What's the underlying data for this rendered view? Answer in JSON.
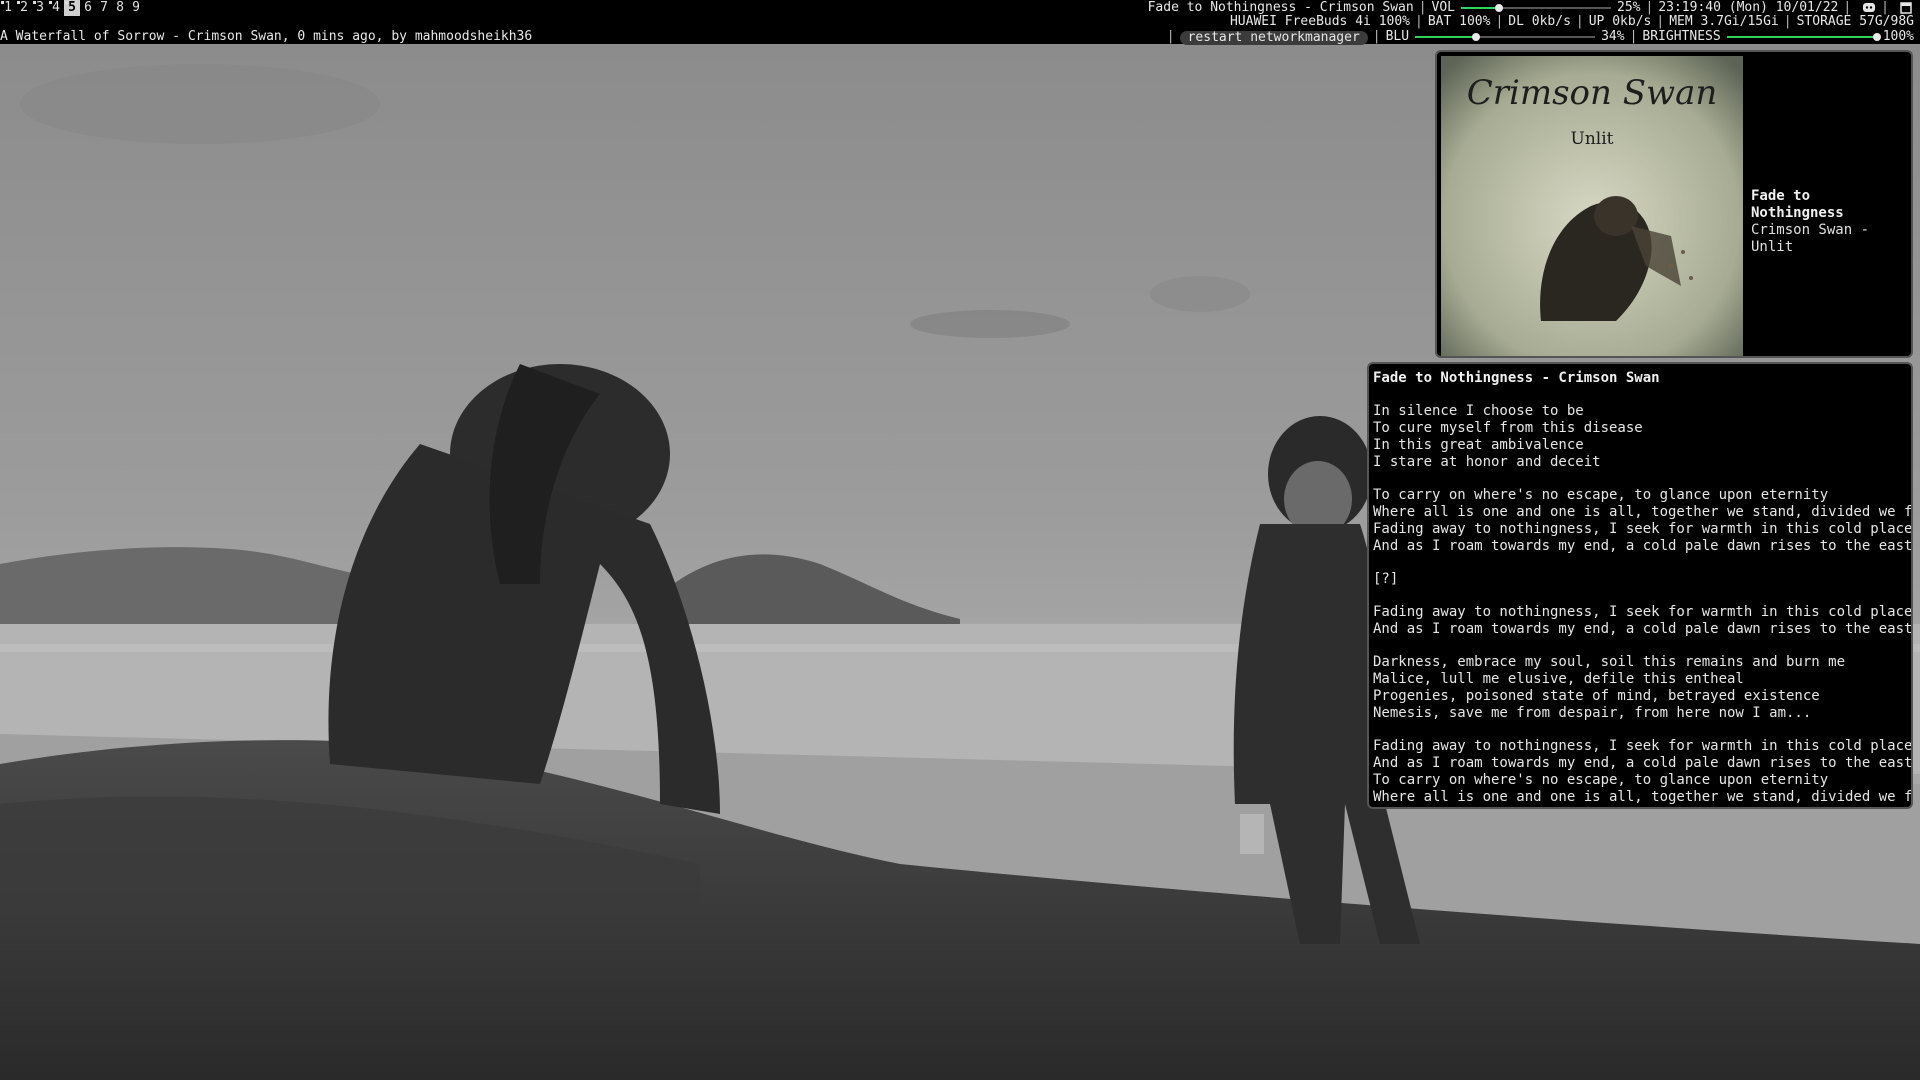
{
  "workspaces": [
    {
      "label": "1",
      "occupied": true,
      "active": false
    },
    {
      "label": "2",
      "occupied": true,
      "active": false
    },
    {
      "label": "3",
      "occupied": true,
      "active": false
    },
    {
      "label": "4",
      "occupied": true,
      "active": false
    },
    {
      "label": "5",
      "occupied": true,
      "active": true
    },
    {
      "label": "6",
      "occupied": false,
      "active": false
    },
    {
      "label": "7",
      "occupied": false,
      "active": false
    },
    {
      "label": "8",
      "occupied": false,
      "active": false
    },
    {
      "label": "9",
      "occupied": false,
      "active": false
    }
  ],
  "bar": {
    "now_playing": "Fade to Nothingness - Crimson Swan",
    "vol_label": "VOL",
    "vol_value": 0.25,
    "vol_text": "25%",
    "clock": "23:19:40 (Mon) 10/01/22",
    "discord_icon": "discord-icon",
    "window_title": "A Waterfall of Sorrow - Crimson Swan, 0 mins ago, by mahmoodsheikh36",
    "status": {
      "bluetooth_device": "HUAWEI FreeBuds 4i 100%",
      "battery": "BAT 100%",
      "download": "DL 0kb/s",
      "upload": "UP 0kb/s",
      "memory": "MEM 3.7Gi/15Gi",
      "storage": "STORAGE 57G/98G"
    },
    "restart_button": "restart networkmanager",
    "blu_label": "BLU",
    "blu_value": 0.34,
    "blu_text": "34%",
    "brightness_label": "BRIGHTNESS",
    "brightness_value": 1.0,
    "brightness_text": "100%"
  },
  "album": {
    "cover_band": "Crimson Swan",
    "cover_album": "Unlit",
    "title": "Fade to Nothingness",
    "subtitle": "Crimson Swan - Unlit"
  },
  "lyrics": {
    "header": "Fade to Nothingness - Crimson Swan",
    "stanzas": [
      [
        "In silence I choose to be",
        "To cure myself from this disease",
        "In this great ambivalence",
        "I stare at honor and deceit"
      ],
      [
        "To carry on where's no escape, to glance upon eternity",
        "Where all is one and one is all, together we stand, divided we fall",
        "Fading away to nothingness, I seek for warmth in this cold place",
        "And as I roam towards my end, a cold pale dawn rises to the east"
      ],
      [
        "[?]"
      ],
      [
        "Fading away to nothingness, I seek for warmth in this cold place",
        "And as I roam towards my end, a cold pale dawn rises to the east"
      ],
      [
        "Darkness, embrace my soul, soil this remains and burn me",
        "Malice, lull me elusive, defile this entheal",
        "Progenies, poisoned state of mind, betrayed existence",
        "Nemesis, save me from despair, from here now I am..."
      ],
      [
        "Fading away to nothingness, I seek for warmth in this cold place",
        "And as I roam towards my end, a cold pale dawn rises to the east",
        "To carry on where's no escape, to glance upon eternity",
        "Where all is one and one is all, together we stand, divided we fall"
      ]
    ]
  },
  "colors": {
    "accent_green": "#2fd35a",
    "active_workspace_bg": "#cfcfcf",
    "widget_border": "#555555"
  }
}
